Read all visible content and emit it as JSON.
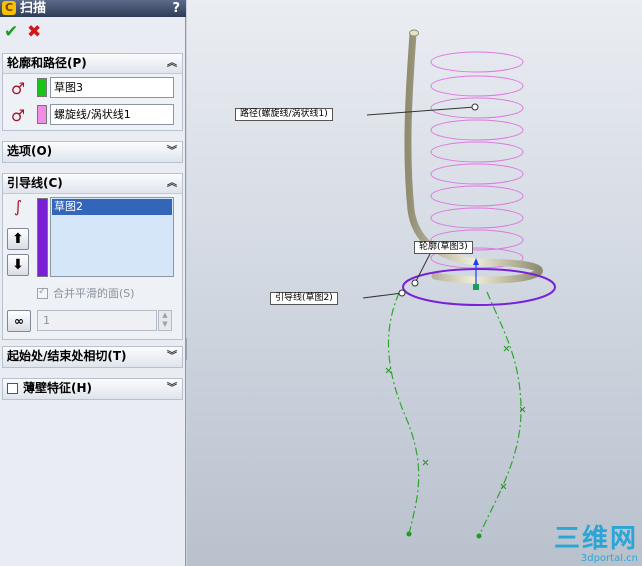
{
  "panel": {
    "title": "扫描",
    "help": "?",
    "ok_glyph": "✔",
    "cancel_glyph": "✖"
  },
  "profile_path": {
    "header": "轮廓和路径(P)",
    "profile_value": "草图3",
    "path_value": "螺旋线/涡状线1",
    "profile_color": "#19c419",
    "path_color": "#f08ee6"
  },
  "options": {
    "header": "选项(O)"
  },
  "guides": {
    "header": "引导线(C)",
    "list_items": [
      "草图2"
    ],
    "list_color": "#7a1fd6",
    "merge_smooth_label": "合并平滑的面(S)",
    "spinner_value": "1"
  },
  "tangency": {
    "header": "起始处/结束处相切(T)"
  },
  "thin": {
    "header": "薄壁特征(H)"
  },
  "callouts": {
    "path": "路径(螺旋线/涡状线1)",
    "profile": "轮廓(草图3)",
    "guide": "引导线(草图2)"
  },
  "watermark": {
    "main": "三维网",
    "sub": "3dportal.cn"
  },
  "colors": {
    "helix": "#dc7ae0",
    "guide_curve": "#2ea52e",
    "profile_circle": "#7a20d8",
    "sweep_body": "#d9d6b8"
  }
}
